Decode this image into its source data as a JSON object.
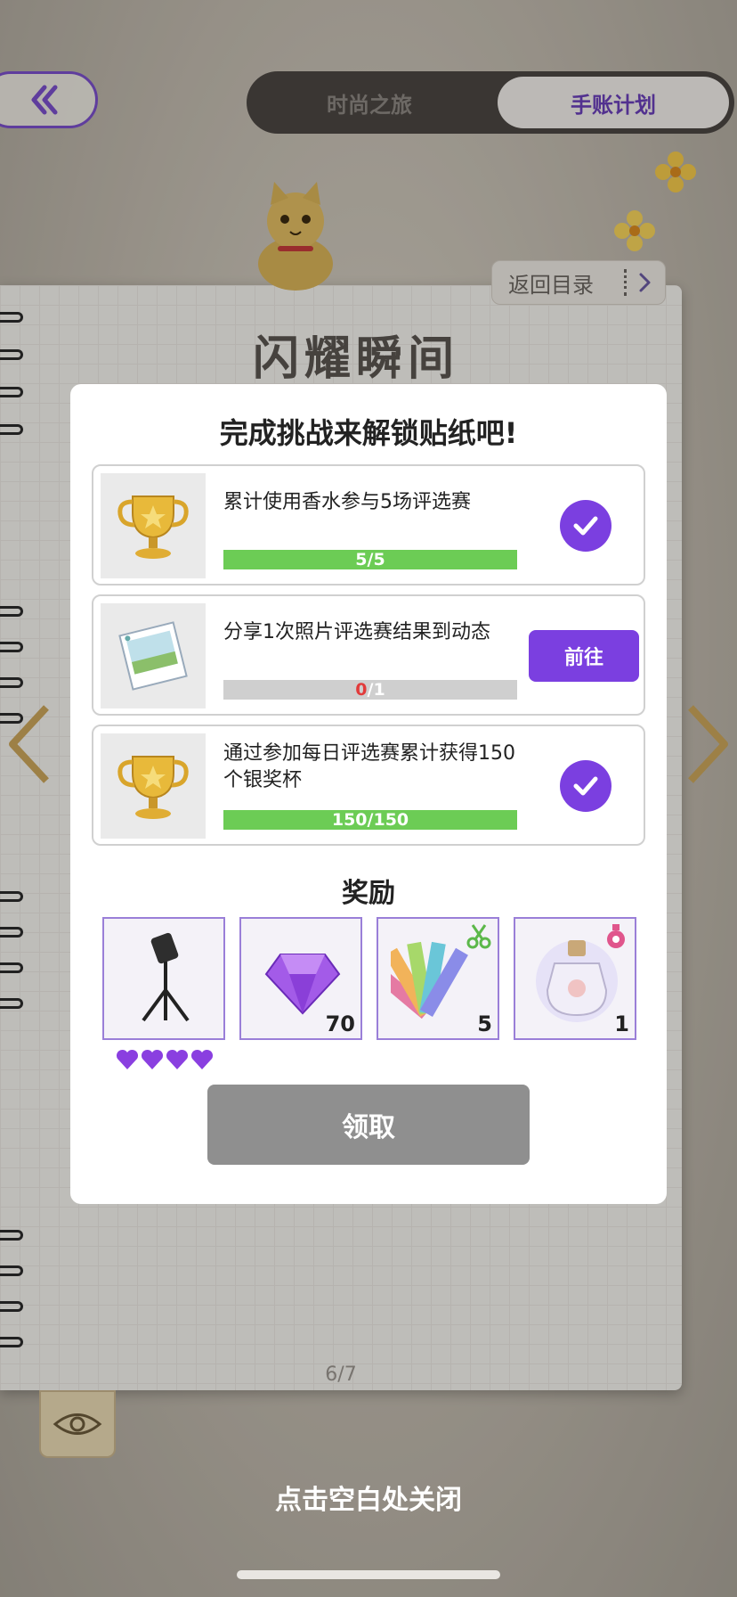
{
  "top_tabs": [
    {
      "label": "时尚之旅",
      "active": false
    },
    {
      "label": "手账计划",
      "active": true
    }
  ],
  "menu_button": {
    "label": "返回目录"
  },
  "page": {
    "title": "闪耀瞬间",
    "page_number": "6/7"
  },
  "dialog": {
    "title": "完成挑战来解锁贴纸吧!",
    "tasks": [
      {
        "text": "累计使用香水参与5场评选赛",
        "current": "5",
        "total": "5",
        "progress": 1.0,
        "status": "completed",
        "icon": "gold-trophy-icon"
      },
      {
        "text": "分享1次照片评选赛结果到动态",
        "current": "0",
        "total": "1",
        "progress": 0.0,
        "status": "pending",
        "action_label": "前往",
        "icon": "photo-card-icon"
      },
      {
        "text": "通过参加每日评选赛累计获得150个银奖杯",
        "current": "150",
        "total": "150",
        "progress": 1.0,
        "status": "completed",
        "icon": "gold-trophy-icon"
      }
    ],
    "reward_heading": "奖励",
    "rewards": [
      {
        "icon": "spotlight-stand-icon",
        "quantity": "",
        "rarity_hearts": 4
      },
      {
        "icon": "purple-diamond-icon",
        "quantity": "70"
      },
      {
        "icon": "color-swatch-fan-icon",
        "quantity": "5",
        "badge": "scissors-icon"
      },
      {
        "icon": "perfume-bottle-icon",
        "quantity": "1",
        "badge": "perfume-badge-icon"
      }
    ],
    "claim_label": "领取"
  },
  "close_hint": "点击空白处关闭",
  "colors": {
    "accent": "#7b3fe0",
    "progress_fill": "#6ccc55",
    "disabled_button": "#8f8f8f"
  }
}
